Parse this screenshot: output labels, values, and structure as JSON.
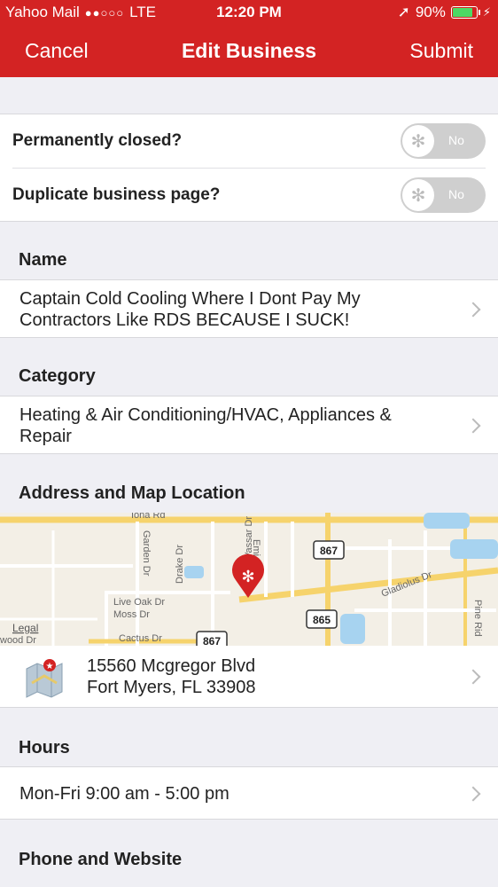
{
  "status_bar": {
    "carrier": "Yahoo Mail",
    "signal": "●●○○○",
    "network": "LTE",
    "time": "12:20 PM",
    "battery": "90%",
    "battery_level": 0.9
  },
  "nav": {
    "cancel": "Cancel",
    "title": "Edit Business",
    "submit": "Submit"
  },
  "toggles": [
    {
      "label": "Permanently closed?",
      "value": "No",
      "on": false
    },
    {
      "label": "Duplicate business page?",
      "value": "No",
      "on": false
    }
  ],
  "name": {
    "header": "Name",
    "line1": "Captain Cold Cooling Where I Dont Pay My",
    "line2": "Contractors Like RDS BECAUSE I SUCK!"
  },
  "category": {
    "header": "Category",
    "line1": "Heating & Air Conditioning/HVAC, Appliances &",
    "line2": "Repair"
  },
  "address": {
    "header": "Address and Map Location",
    "line1": "15560 Mcgregor Blvd",
    "line2": "Fort Myers, FL 33908",
    "map_labels": {
      "iona": "Iona Rd",
      "garden": "Garden Dr",
      "drake": "Drake Dr",
      "emily": "Emi",
      "vassar": "Vassar Dr",
      "gladiolus": "Gladiolus Dr",
      "pine": "Pine Rid",
      "liveoak": "Live Oak Dr",
      "moss": "Moss Dr",
      "cactus": "Cactus Dr",
      "legal": "Legal",
      "wood": "wood Dr",
      "r867": "867",
      "r865": "865",
      "r867b": "867"
    }
  },
  "hours": {
    "header": "Hours",
    "value": "Mon-Fri 9:00 am - 5:00 pm"
  },
  "phone": {
    "header": "Phone and Website"
  },
  "colors": {
    "brand": "#d32323",
    "background": "#efeff4",
    "toggle_off": "#cfcfcf"
  }
}
